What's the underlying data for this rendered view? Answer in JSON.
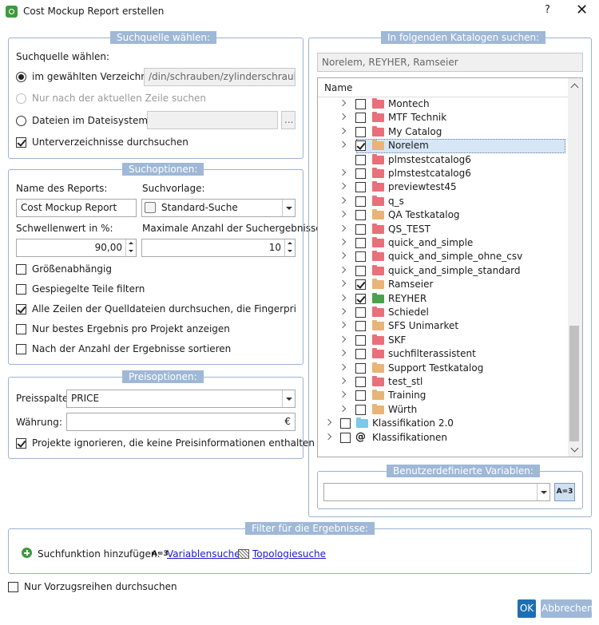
{
  "window": {
    "title": "Cost Mockup Report erstellen",
    "help": "?",
    "close": "✕"
  },
  "search_source": {
    "group_title": "Suchquelle wählen:",
    "label": "Suchquelle wählen:",
    "option_directory": "im gewählten Verzeichnis:",
    "directory_value": "/din/schrauben/zylinderschrauben",
    "option_current_row": "Nur nach der aktuellen Zeile suchen",
    "option_files": "Dateien im Dateisystem:",
    "browse_label": "...",
    "subdirs": "Unterverzeichnisse durchsuchen"
  },
  "search_options": {
    "group_title": "Suchoptionen:",
    "report_name_label": "Name des Reports:",
    "report_name_value": "Cost Mockup Report",
    "template_label": "Suchvorlage:",
    "template_value": "Standard-Suche",
    "threshold_label": "Schwellenwert in %:",
    "threshold_value": "90,00",
    "max_results_label": "Maximale Anzahl der Suchergebnisse:",
    "max_results_value": "10",
    "size_dependent": "Größenabhängig",
    "mirrored": "Gespiegelte Teile filtern",
    "all_rows": "Alle Zeilen der Quelldateien durchsuchen, die Fingerprints entha",
    "best_per_project": "Nur bestes Ergebnis pro Projekt anzeigen",
    "sort_by_count": "Nach der Anzahl der Ergebnisse sortieren"
  },
  "price_options": {
    "group_title": "Preisoptionen:",
    "price_column_label": "Preisspalte:",
    "price_column_value": "PRICE",
    "currency_label": "Währung:",
    "currency_symbol": "€",
    "ignore_projects": "Projekte ignorieren, die keine Preisinformationen enthalten"
  },
  "catalogs": {
    "group_title": "In folgenden Katalogen suchen:",
    "summary": "Norelem, REYHER, Ramseier",
    "column_header": "Name",
    "items": [
      {
        "label": "Montech",
        "checked": false,
        "color": "red",
        "expandable": true
      },
      {
        "label": "MTF Technik",
        "checked": false,
        "color": "red",
        "expandable": true
      },
      {
        "label": "My Catalog",
        "checked": false,
        "color": "red",
        "expandable": true
      },
      {
        "label": "Norelem",
        "checked": true,
        "color": "orange",
        "expandable": true,
        "selected": true
      },
      {
        "label": "plmstestcatalog6",
        "checked": false,
        "color": "red",
        "expandable": false
      },
      {
        "label": "plmstestcatalog6",
        "checked": false,
        "color": "red",
        "expandable": true
      },
      {
        "label": "previewtest45",
        "checked": false,
        "color": "red",
        "expandable": true
      },
      {
        "label": "q_s",
        "checked": false,
        "color": "red",
        "expandable": true
      },
      {
        "label": "QA Testkatalog",
        "checked": false,
        "color": "orange",
        "expandable": true
      },
      {
        "label": "QS_TEST",
        "checked": false,
        "color": "red",
        "expandable": true
      },
      {
        "label": "quick_and_simple",
        "checked": false,
        "color": "red",
        "expandable": true
      },
      {
        "label": "quick_and_simple_ohne_csv",
        "checked": false,
        "color": "red",
        "expandable": true
      },
      {
        "label": "quick_and_simple_standard",
        "checked": false,
        "color": "red",
        "expandable": true
      },
      {
        "label": "Ramseier",
        "checked": true,
        "color": "orange",
        "expandable": true
      },
      {
        "label": "REYHER",
        "checked": true,
        "color": "green",
        "expandable": true
      },
      {
        "label": "Schiedel",
        "checked": false,
        "color": "red",
        "expandable": true
      },
      {
        "label": "SFS Unimarket",
        "checked": false,
        "color": "orange",
        "expandable": true
      },
      {
        "label": "SKF",
        "checked": false,
        "color": "red",
        "expandable": true
      },
      {
        "label": "suchfilterassistent",
        "checked": false,
        "color": "red",
        "expandable": true
      },
      {
        "label": "Support Testkatalog",
        "checked": false,
        "color": "orange",
        "expandable": true
      },
      {
        "label": "test_stl",
        "checked": false,
        "color": "red",
        "expandable": true
      },
      {
        "label": "Training",
        "checked": false,
        "color": "orange",
        "expandable": true
      },
      {
        "label": "Würth",
        "checked": false,
        "color": "orange",
        "expandable": true
      }
    ],
    "root_items": [
      {
        "label": "Klassifikation 2.0",
        "icon": "blue-folder-icon"
      },
      {
        "label": "Klassifikationen",
        "icon": "at-icon",
        "glyph": "@"
      }
    ]
  },
  "user_vars": {
    "group_title": "Benutzerdefinierte Variablen:",
    "icon_text": "A=3"
  },
  "result_filter": {
    "group_title": "Filter für die Ergebnisse:",
    "add_label": "Suchfunktion hinzufügen:",
    "var_icon_text": "A=3",
    "var_search": "Variablensuche",
    "topo_search": "Topologiesuche"
  },
  "preferred_only": "Nur Vorzugsreihen durchsuchen",
  "buttons": {
    "ok": "OK",
    "cancel": "Abbrechen"
  }
}
